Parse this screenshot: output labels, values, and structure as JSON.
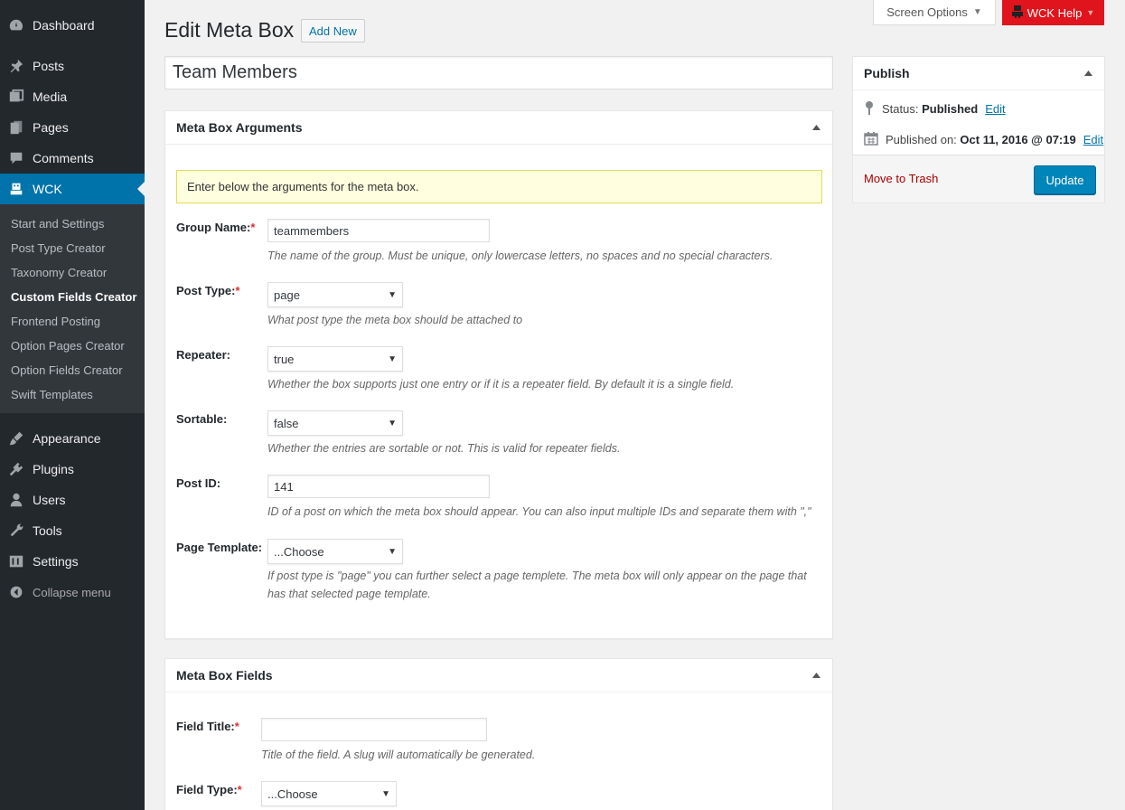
{
  "sidebar": {
    "items": [
      {
        "label": "Dashboard",
        "icon": "dashboard-icon"
      },
      {
        "label": "Posts",
        "icon": "pin-icon"
      },
      {
        "label": "Media",
        "icon": "media-icon"
      },
      {
        "label": "Pages",
        "icon": "pages-icon"
      },
      {
        "label": "Comments",
        "icon": "comment-icon"
      },
      {
        "label": "WCK",
        "icon": "wck-robot-icon"
      },
      {
        "label": "Appearance",
        "icon": "brush-icon"
      },
      {
        "label": "Plugins",
        "icon": "plug-icon"
      },
      {
        "label": "Users",
        "icon": "user-icon"
      },
      {
        "label": "Tools",
        "icon": "wrench-icon"
      },
      {
        "label": "Settings",
        "icon": "sliders-icon"
      }
    ],
    "submenu": [
      "Start and Settings",
      "Post Type Creator",
      "Taxonomy Creator",
      "Custom Fields Creator",
      "Frontend Posting",
      "Option Pages Creator",
      "Option Fields Creator",
      "Swift Templates"
    ],
    "collapse_label": "Collapse menu"
  },
  "topbar": {
    "screen_options": "Screen Options",
    "wck_help": "WCK Help"
  },
  "header": {
    "title": "Edit Meta Box",
    "add_new": "Add New"
  },
  "post_title": "Team Members",
  "args_box": {
    "title": "Meta Box Arguments",
    "notice": "Enter below the arguments for the meta box.",
    "group_name": {
      "label": "Group Name:",
      "value": "teammembers",
      "desc": "The name of the group. Must be unique, only lowercase letters, no spaces and no special characters."
    },
    "post_type": {
      "label": "Post Type:",
      "value": "page",
      "desc": "What post type the meta box should be attached to"
    },
    "repeater": {
      "label": "Repeater:",
      "value": "true",
      "desc": "Whether the box supports just one entry or if it is a repeater field. By default it is a single field."
    },
    "sortable": {
      "label": "Sortable:",
      "value": "false",
      "desc": "Whether the entries are sortable or not. This is valid for repeater fields."
    },
    "post_id": {
      "label": "Post ID:",
      "value": "141",
      "desc": "ID of a post on which the meta box should appear. You can also input multiple IDs and separate them with \",\""
    },
    "page_template": {
      "label": "Page Template:",
      "value": "...Choose",
      "desc": "If post type is \"page\" you can further select a page templete. The meta box will only appear on the page that has that selected page template."
    }
  },
  "fields_box": {
    "title": "Meta Box Fields",
    "field_title": {
      "label": "Field Title:",
      "value": "",
      "desc": "Title of the field. A slug will automatically be generated."
    },
    "field_type": {
      "label": "Field Type:",
      "value": "...Choose"
    }
  },
  "publish": {
    "title": "Publish",
    "status_label": "Status:",
    "status_value": "Published",
    "edit": "Edit",
    "published_label": "Published on:",
    "published_value": "Oct 11, 2016 @ 07:19",
    "move_to_trash": "Move to Trash",
    "update": "Update"
  },
  "colors": {
    "sidebar_bg": "#23282d",
    "active_bg": "#0073aa",
    "help_red": "#e0141c",
    "primary": "#0085ba"
  }
}
